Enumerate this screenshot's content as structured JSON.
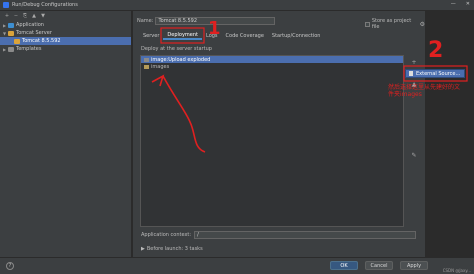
{
  "window": {
    "title": "Run/Debug Configurations",
    "controls": {
      "minimize": "—",
      "close": "✕"
    }
  },
  "left_toolbar": [
    "+",
    "−",
    "⎘",
    "▲",
    "▼"
  ],
  "tree": {
    "application": "Application",
    "tomcat_server": "Tomcat Server",
    "tomcat_config": "Tomcat 8.5.592",
    "templates": "Templates"
  },
  "config": {
    "name_label": "Name:",
    "name_value": "Tomcat 8.5.592",
    "store_label": "Store as project file"
  },
  "tabs": [
    "Server",
    "Deployment",
    "Logs",
    "Code Coverage",
    "Startup/Connection"
  ],
  "deployment": {
    "label": "Deploy at the server startup",
    "artifacts": [
      {
        "label": "image:Upload exploded"
      },
      {
        "label": "images"
      }
    ],
    "side_buttons": [
      "+",
      "−",
      "▲",
      "✎"
    ],
    "popup_label": "External Source..."
  },
  "context": {
    "label": "Application context:",
    "value": "/"
  },
  "before_launch": "Before launch: 3 tasks",
  "footer": {
    "help": "?",
    "ok": "OK",
    "cancel": "Cancel",
    "apply": "Apply",
    "watermark": "CSDN @Jaxy..."
  },
  "annotations": {
    "num1": "1",
    "num2": "2",
    "note": "然后选择这里从先建好的文件夹images"
  },
  "colors": {
    "accent": "#4b6eaf",
    "annotation": "#e02020",
    "tab_underline": "#4a88c7",
    "ok_button": "#365880"
  }
}
